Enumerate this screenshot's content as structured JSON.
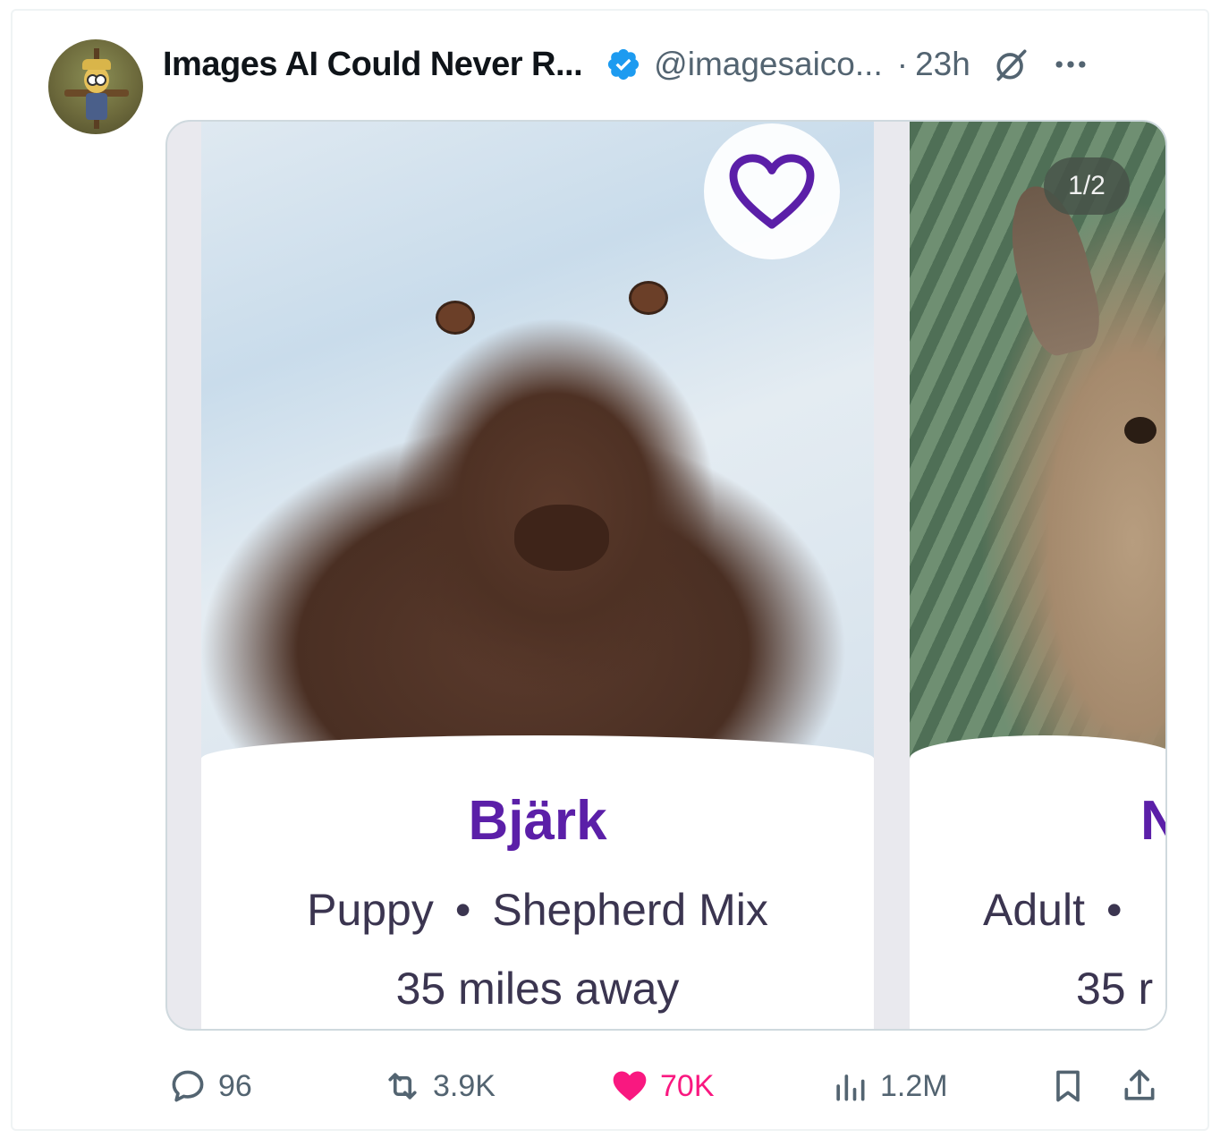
{
  "author": {
    "display_name": "Images AI Could Never R...",
    "handle": "@imagesaico...",
    "separator": "·",
    "time": "23h",
    "avatar_icon": "scarecrow-avatar",
    "verified_color": "#1d9bf0"
  },
  "media": {
    "counter": "1/2",
    "cards": [
      {
        "name": "Bjärk",
        "age": "Puppy",
        "dot": "•",
        "breed": "Shepherd Mix",
        "distance": "35 miles away",
        "favorite_icon": "heart-outline-icon"
      },
      {
        "name": "N",
        "age": "Adult",
        "dot": "•",
        "distance": "35 r"
      }
    ],
    "accent_color": "#5b1fa8"
  },
  "actions": {
    "replies": "96",
    "reposts": "3.9K",
    "likes": "70K",
    "views": "1.2M",
    "like_color": "#f91880"
  }
}
